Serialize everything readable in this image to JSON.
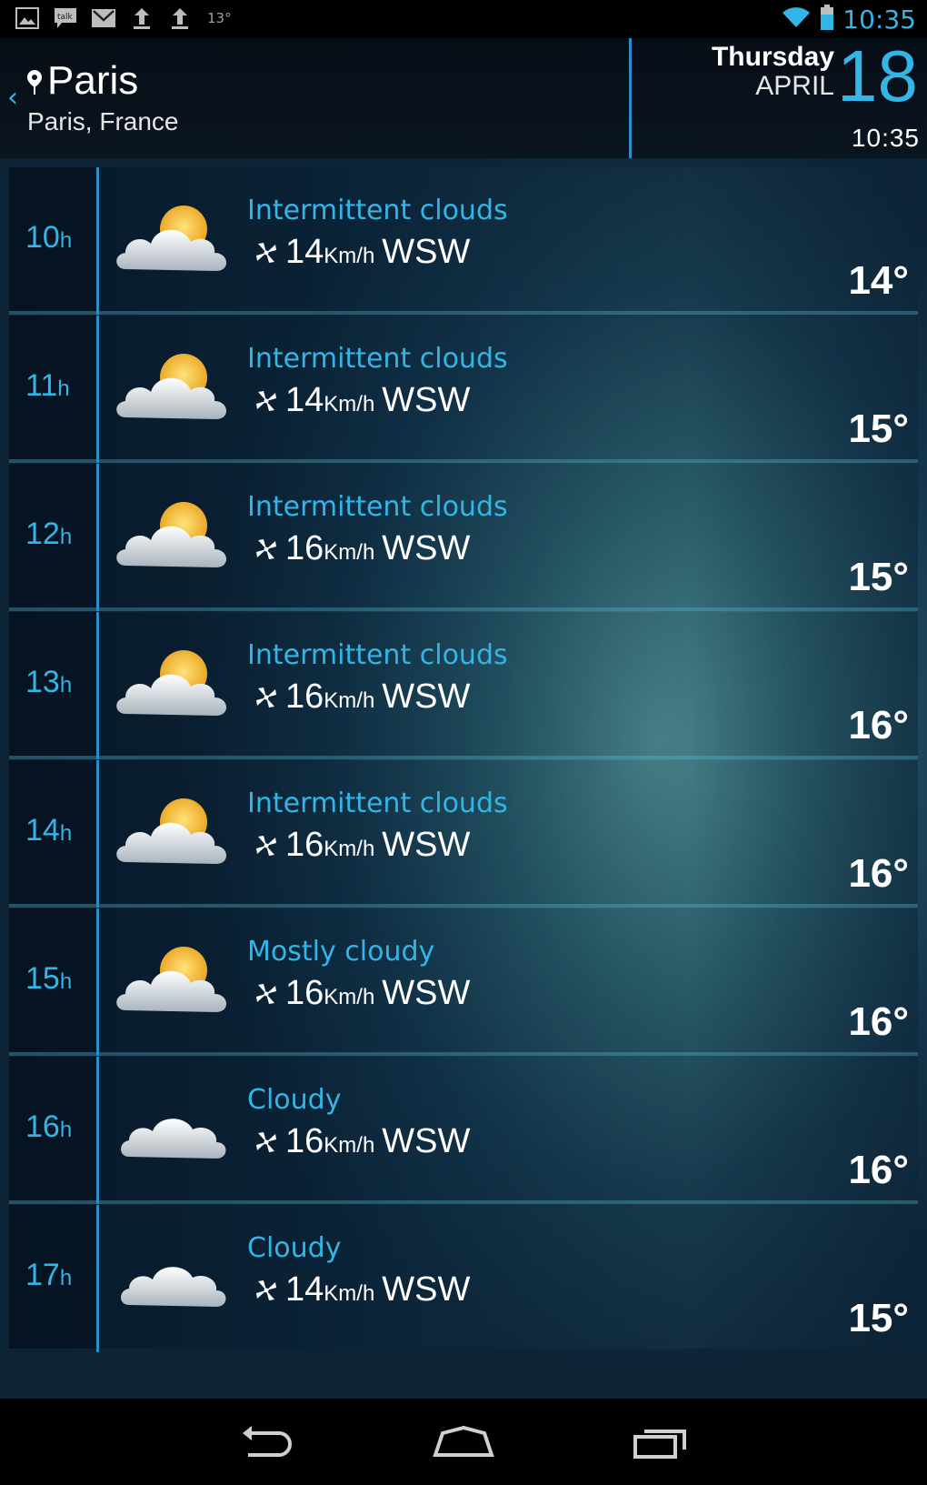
{
  "status_bar": {
    "left_icons": [
      "gallery-icon",
      "talk-icon",
      "gmail-icon",
      "upload-icon",
      "upload-icon"
    ],
    "temp": "13°",
    "time": "10:35"
  },
  "header": {
    "city": "Paris",
    "region": "Paris, France",
    "day_name": "Thursday",
    "month": "APRIL",
    "day_number": "18",
    "time": "10:35"
  },
  "colors": {
    "accent": "#33b5e5",
    "text": "#ffffff"
  },
  "forecast": [
    {
      "hour": "10",
      "suffix": "h",
      "condition": "Intermittent clouds",
      "icon": "sun-cloud-icon",
      "wind_speed": "14",
      "wind_unit": "Km/h",
      "wind_dir": "WSW",
      "temp": "14°"
    },
    {
      "hour": "11",
      "suffix": "h",
      "condition": "Intermittent clouds",
      "icon": "sun-cloud-icon",
      "wind_speed": "14",
      "wind_unit": "Km/h",
      "wind_dir": "WSW",
      "temp": "15°"
    },
    {
      "hour": "12",
      "suffix": "h",
      "condition": "Intermittent clouds",
      "icon": "sun-cloud-icon",
      "wind_speed": "16",
      "wind_unit": "Km/h",
      "wind_dir": "WSW",
      "temp": "15°"
    },
    {
      "hour": "13",
      "suffix": "h",
      "condition": "Intermittent clouds",
      "icon": "sun-cloud-icon",
      "wind_speed": "16",
      "wind_unit": "Km/h",
      "wind_dir": "WSW",
      "temp": "16°"
    },
    {
      "hour": "14",
      "suffix": "h",
      "condition": "Intermittent clouds",
      "icon": "sun-cloud-icon",
      "wind_speed": "16",
      "wind_unit": "Km/h",
      "wind_dir": "WSW",
      "temp": "16°"
    },
    {
      "hour": "15",
      "suffix": "h",
      "condition": "Mostly cloudy",
      "icon": "sun-cloud-icon",
      "wind_speed": "16",
      "wind_unit": "Km/h",
      "wind_dir": "WSW",
      "temp": "16°"
    },
    {
      "hour": "16",
      "suffix": "h",
      "condition": "Cloudy",
      "icon": "cloud-icon",
      "wind_speed": "16",
      "wind_unit": "Km/h",
      "wind_dir": "WSW",
      "temp": "16°"
    },
    {
      "hour": "17",
      "suffix": "h",
      "condition": "Cloudy",
      "icon": "cloud-icon",
      "wind_speed": "14",
      "wind_unit": "Km/h",
      "wind_dir": "WSW",
      "temp": "15°"
    }
  ],
  "nav": {
    "buttons": [
      "back-icon",
      "home-icon",
      "recent-apps-icon"
    ]
  }
}
